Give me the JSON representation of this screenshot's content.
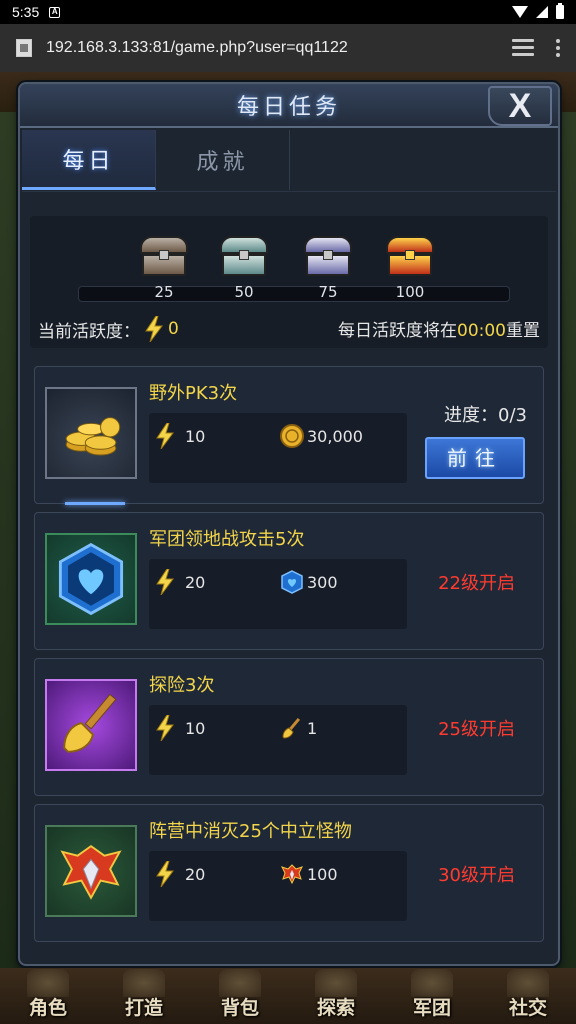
{
  "status_bar": {
    "time": "5:35"
  },
  "browser": {
    "url": "192.168.3.133:81/game.php?user=qq1122"
  },
  "modal": {
    "title": "每日任务",
    "close_label": "X",
    "tabs": [
      {
        "label": "每日",
        "active": true
      },
      {
        "label": "成就",
        "active": false
      }
    ]
  },
  "activity": {
    "tiers": [
      "25",
      "50",
      "75",
      "100"
    ],
    "current_label": "当前活跃度：",
    "current_value": "0",
    "reset_prefix": "每日活跃度将在",
    "reset_time": "00:00",
    "reset_suffix": "重置"
  },
  "tasks": [
    {
      "title": "野外PK3次",
      "energy": "10",
      "reward_icon": "gold-coin-icon",
      "reward_value": "30,000",
      "progress": "进度：0/3",
      "button": "前往"
    },
    {
      "title": "军团领地战攻击5次",
      "energy": "20",
      "reward_icon": "heart-shield-icon",
      "reward_value": "300",
      "lock": "22级开启"
    },
    {
      "title": "探险3次",
      "energy": "10",
      "reward_icon": "shovel-icon",
      "reward_value": "1",
      "lock": "25级开启"
    },
    {
      "title": "阵营中消灭25个中立怪物",
      "energy": "20",
      "reward_icon": "winged-emblem-icon",
      "reward_value": "100",
      "lock": "30级开启"
    }
  ],
  "bottom_nav": [
    "角色",
    "打造",
    "背包",
    "探索",
    "军团",
    "社交"
  ],
  "colors": {
    "accent": "#f2d54a",
    "lock_red": "#ff3b30",
    "button_blue": "#2c5fc0",
    "panel_bg": "#1d2531"
  }
}
